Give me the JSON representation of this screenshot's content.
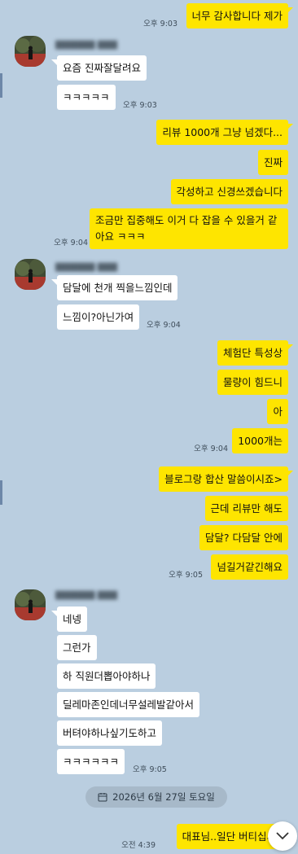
{
  "messages": [
    {
      "text": "너무 감사합니다 제가",
      "time": "오후 9:03"
    },
    {
      "text": "요즘 진짜잘달려요"
    },
    {
      "text": "ㅋㅋㅋㅋㅋ",
      "time": "오후 9:03"
    },
    {
      "text": "리뷰 1000개 그냥 넘겠다..."
    },
    {
      "text": "진짜"
    },
    {
      "text": "각성하고 신경쓰겠습니다"
    },
    {
      "text": "조금만 집중해도 이거 다 잡을 수 있을거 같아요 ㅋㅋㅋ",
      "time": "오후 9:04"
    },
    {
      "text": "담달에 천개 찍을느낌인데"
    },
    {
      "text": "느낌이?아닌가여",
      "time": "오후 9:04"
    },
    {
      "text": "체험단 특성상"
    },
    {
      "text": "물량이 힘드니"
    },
    {
      "text": "아"
    },
    {
      "text": "1000개는",
      "time": "오후 9:04"
    },
    {
      "text": "블로그랑 합산 말씀이시죠>"
    },
    {
      "text": "근데 리뷰만 해도"
    },
    {
      "text": "담달? 다담달 안에"
    },
    {
      "text": "넘길거같긴해요",
      "time": "오후 9:05"
    },
    {
      "text": "네넹"
    },
    {
      "text": "그런가"
    },
    {
      "text": "하 직원더뽑아야하나"
    },
    {
      "text": "딜레마존인데너무설레발같아서"
    },
    {
      "text": "버텨야하나싶기도하고"
    },
    {
      "text": "ㅋㅋㅋㅋㅋㅋ",
      "time": "오후 9:05"
    },
    {
      "text": "대표님..일단 버티십셔..",
      "time": "오전 4:39"
    }
  ],
  "date_divider": "2026년 6월 27일 토요일",
  "icons": {
    "date": "calendar-icon",
    "scroll": "chevron-down-icon",
    "avatar": "profile-photo"
  },
  "colors": {
    "background": "#bacee0",
    "my_bubble": "#fee500",
    "other_bubble": "#ffffff"
  }
}
